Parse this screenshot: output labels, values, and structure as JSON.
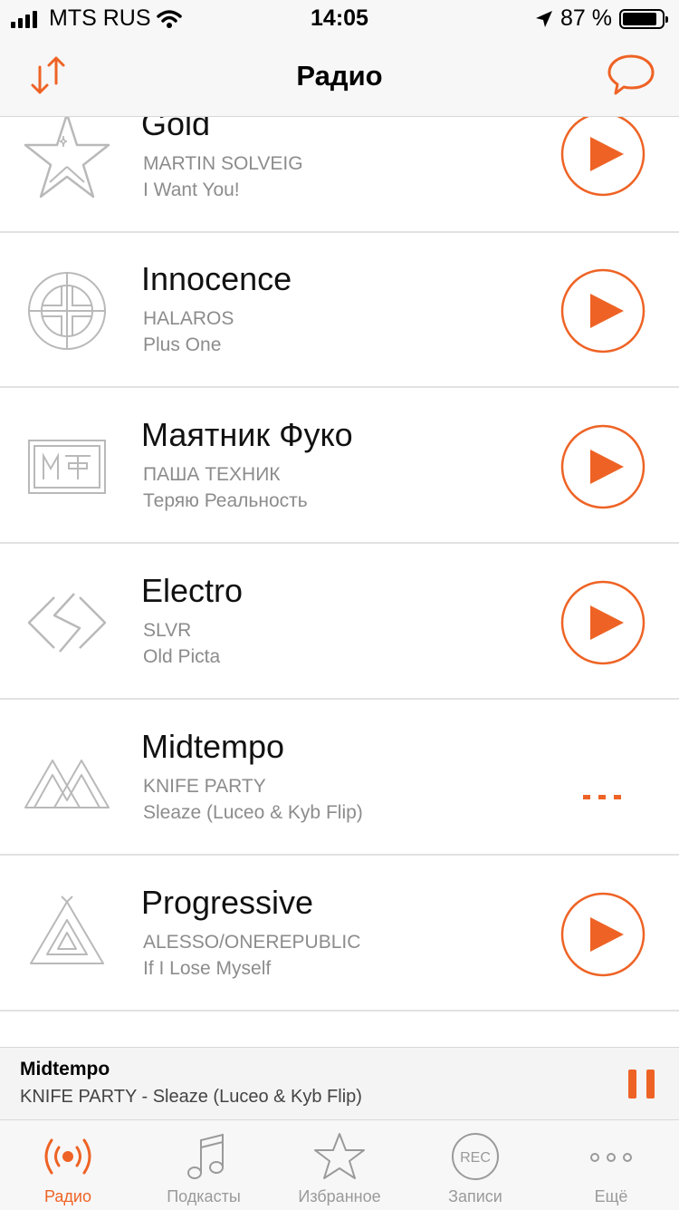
{
  "status_bar": {
    "carrier": "MTS RUS",
    "time": "14:05",
    "battery": "87 %",
    "battery_level": 0.87
  },
  "nav": {
    "title": "Радио"
  },
  "stations": [
    {
      "name": "Gold",
      "artist": "MARTIN SOLVEIG",
      "track": "I Want You!",
      "state": "play",
      "logo": "star-icon"
    },
    {
      "name": "Innocence",
      "artist": "HALAROS",
      "track": "Plus One",
      "state": "play",
      "logo": "crosshair-circle-icon"
    },
    {
      "name": "Маятник Фуко",
      "artist": "ПАША ТЕХНИК",
      "track": "Теряю Реальность",
      "state": "play",
      "logo": "mt-frame-icon"
    },
    {
      "name": "Electro",
      "artist": "SLVR",
      "track": "Old Picta",
      "state": "play",
      "logo": "bolt-diamond-icon"
    },
    {
      "name": "Midtempo",
      "artist": "KNIFE PARTY",
      "track": "Sleaze (Luceo & Kyb Flip)",
      "state": "loading",
      "logo": "mountains-icon"
    },
    {
      "name": "Progressive",
      "artist": "ALESSO/ONEREPUBLIC",
      "track": "If I Lose Myself",
      "state": "play",
      "logo": "triangle-icon"
    }
  ],
  "mini_player": {
    "title": "Midtempo",
    "subtitle": "KNIFE PARTY - Sleaze (Luceo & Kyb Flip)"
  },
  "tabs": [
    {
      "label": "Радио",
      "icon": "radio-icon",
      "active": true
    },
    {
      "label": "Подкасты",
      "icon": "music-note-icon",
      "active": false
    },
    {
      "label": "Избранное",
      "icon": "star-icon",
      "active": false
    },
    {
      "label": "Записи",
      "icon": "rec-icon",
      "active": false
    },
    {
      "label": "Ещё",
      "icon": "more-icon",
      "active": false
    }
  ],
  "colors": {
    "accent": "#ee6325",
    "muted_text": "#8c8c8c",
    "logo_gray": "#b9b9b9"
  }
}
